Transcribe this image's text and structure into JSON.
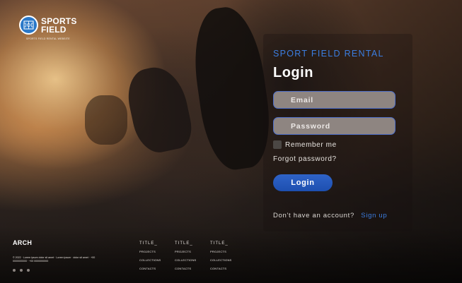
{
  "logo": {
    "line1": "SPORTS",
    "line2": "FIELD",
    "tagline": "SPORTS FIELD RENTAL WEBSITE"
  },
  "login": {
    "kicker": "SPORT FIELD RENTAL",
    "title": "Login",
    "email_placeholder": "Email",
    "password_placeholder": "Password",
    "remember_label": "Remember me",
    "forgot_label": "Forgot password?",
    "button_label": "Login",
    "signup_prompt": "Don't have an account?",
    "signup_link": "Sign up"
  },
  "footer": {
    "brand": "ARCH",
    "copyright": "© 2022 · Lorem ipsum dolor sit amet · Lorem ipsum · dolor sit amet · +00 0000000000 · +00 0000000000",
    "columns": [
      {
        "title": "TITLE_",
        "links": [
          "PROJECTS",
          "COLLECTIONS",
          "CONTACTS"
        ]
      },
      {
        "title": "TITLE_",
        "links": [
          "PROJECTS",
          "COLLECTIONS",
          "CONTACTS"
        ]
      },
      {
        "title": "TITLE_",
        "links": [
          "PROJECTS",
          "COLLECTIONS",
          "CONTACTS"
        ]
      }
    ]
  },
  "colors": {
    "accent": "#3b7de0",
    "button": "#1d4fb0",
    "field_bg": "#8e8581"
  },
  "icons": [
    "sports-field-logo-icon",
    "checkbox-icon",
    "social-icon"
  ]
}
